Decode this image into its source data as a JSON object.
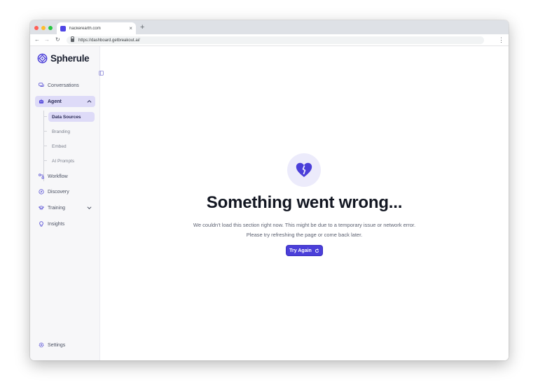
{
  "browser": {
    "tab_title": "hackerearth.com",
    "tab_close": "×",
    "new_tab": "+",
    "url": "https://dashboard.getbreakout.ai/",
    "nav_back": "←",
    "nav_forward": "→",
    "nav_reload": "↻",
    "menu": "⋮"
  },
  "sidebar": {
    "brand": "Spherule",
    "items": [
      {
        "label": "Conversations",
        "icon": "chat-icon"
      },
      {
        "label": "Agent",
        "icon": "bot-icon",
        "active": true,
        "expanded": true
      },
      {
        "label": "Workflow",
        "icon": "workflow-icon"
      },
      {
        "label": "Discovery",
        "icon": "compass-icon"
      },
      {
        "label": "Training",
        "icon": "graduation-cap-icon"
      },
      {
        "label": "Insights",
        "icon": "lightbulb-icon"
      },
      {
        "label": "Settings",
        "icon": "gear-icon"
      }
    ],
    "agent_subitems": [
      {
        "label": "Data Sources",
        "active": true
      },
      {
        "label": "Branding"
      },
      {
        "label": "Embed"
      },
      {
        "label": "AI Prompts"
      }
    ]
  },
  "error": {
    "icon": "broken-heart-icon",
    "title": "Something went wrong...",
    "line1": "We couldn't load this section right now. This might be due to a temporary issue or network error.",
    "line2": "Please try refreshing the page or come back later.",
    "button_label": "Try Again"
  },
  "colors": {
    "accent": "#4b3fd9",
    "accent_soft": "#dedbf8",
    "sidebar_bg": "#f7f7f9"
  }
}
